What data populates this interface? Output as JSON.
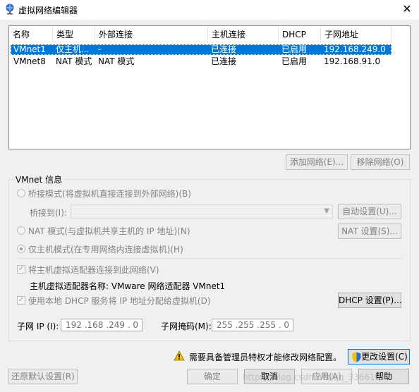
{
  "window": {
    "title": "虚拟网络编辑器",
    "close_glyph": "✕"
  },
  "table": {
    "columns": [
      "名称",
      "类型",
      "外部连接",
      "主机连接",
      "DHCP",
      "子网地址"
    ],
    "rows": [
      {
        "name": "VMnet1",
        "type": "仅主机...",
        "external": "-",
        "host": "已连接",
        "dhcp": "已启用",
        "subnet": "192.168.249.0",
        "selected": true
      },
      {
        "name": "VMnet8",
        "type": "NAT 模式",
        "external": "NAT 模式",
        "host": "已连接",
        "dhcp": "已启用",
        "subnet": "192.168.91.0",
        "selected": false
      }
    ]
  },
  "list_buttons": {
    "add": "添加网络(E)...",
    "remove": "移除网络(O)"
  },
  "vmnet_info": {
    "group_title": "VMnet 信息",
    "bridge_label": "桥接模式(将虚拟机直接连接到外部网络)(B)",
    "bridge_to_label": "桥接到(I):",
    "bridge_to_value": "",
    "auto_settings": "自动设置(U)...",
    "nat_label": "NAT 模式(与虚拟机共享主机的 IP 地址)(N)",
    "nat_settings": "NAT 设置(S)...",
    "hostonly_label": "仅主机模式(在专用网络内连接虚拟机)(H)",
    "connect_adapter_label": "将主机虚拟适配器连接到此网络(V)",
    "adapter_name_label": "主机虚拟适配器名称: VMware 网络适配器 VMnet1",
    "dhcp_label": "使用本地 DHCP 服务将 IP 地址分配给虚拟机(D)",
    "dhcp_settings": "DHCP 设置(P)...",
    "subnet_ip_label": "子网 IP (I):",
    "subnet_ip_value": "192 .168 .249 . 0",
    "subnet_mask_label": "子网掩码(M):",
    "subnet_mask_value": "255 .255 .255 . 0"
  },
  "admin_notice": {
    "text": "需要具备管理员特权才能修改网络配置。",
    "change_settings": "更改设置(C)"
  },
  "footer": {
    "restore_defaults": "还原默认设置(R)",
    "ok": "确定",
    "cancel": "取消",
    "apply": "应用(A)",
    "help": "帮助"
  },
  "watermark": "https://blog.csdn.net/qq_33661065",
  "colors": {
    "selection": "#0078d7",
    "warning": "#f2c200",
    "shield_blue": "#2f6fcf",
    "shield_yellow": "#f2c200"
  }
}
